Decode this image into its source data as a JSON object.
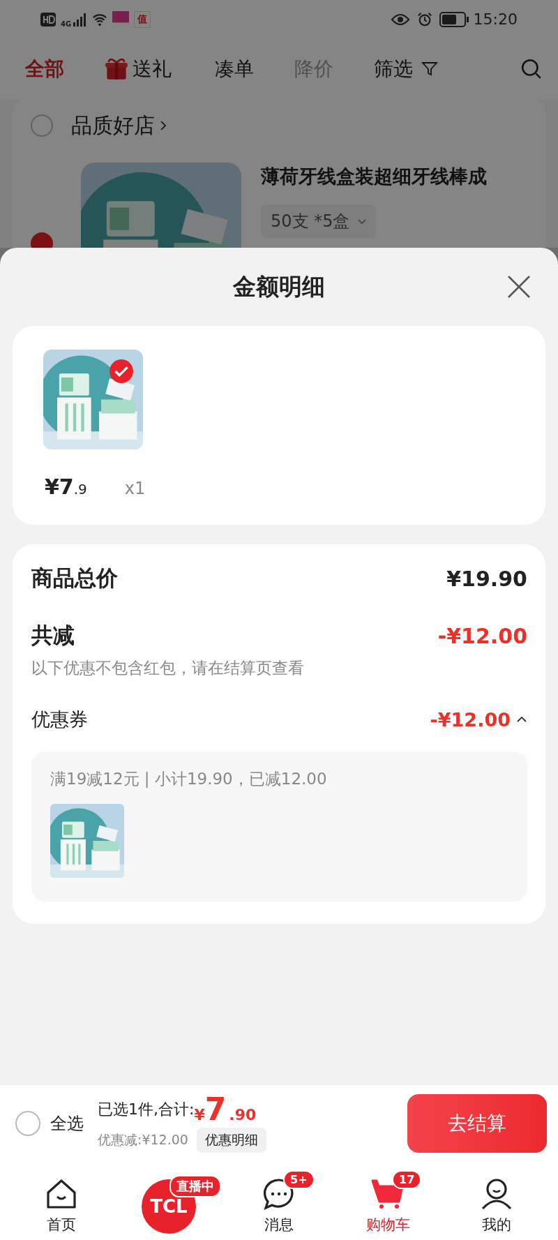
{
  "status_bar": {
    "network": "4G",
    "app_badge": "值",
    "time": "15:20"
  },
  "tabs": [
    {
      "label": "全部",
      "kind": "plain",
      "selected": true,
      "disabled": false
    },
    {
      "label": "送礼",
      "kind": "gift",
      "selected": false,
      "disabled": false
    },
    {
      "label": "凑单",
      "kind": "plain",
      "selected": false,
      "disabled": false
    },
    {
      "label": "降价",
      "kind": "plain",
      "selected": false,
      "disabled": true
    },
    {
      "label": "筛选",
      "kind": "filter",
      "selected": false,
      "disabled": false
    }
  ],
  "store": {
    "name": "品质好店",
    "checked": false
  },
  "product": {
    "title": "薄荷牙线盒装超细牙线棒成",
    "spec": "50支 *5盒",
    "checked": true
  },
  "sheet": {
    "title": "金额明细",
    "items": [
      {
        "price_main": "¥7",
        "price_decimal": ".9",
        "quantity": "x1",
        "checked": true
      }
    ],
    "summary": {
      "total_label": "商品总价",
      "total": "¥19.90",
      "discount_label": "共减",
      "discount": "-¥12.00",
      "note": "以下优惠不包含红包，请在结算页查看",
      "coupon_label": "优惠券",
      "coupon_amount": "-¥12.00",
      "coupon_expanded": true,
      "coupon_detail": "满19减12元 | 小计19.90，已减12.00"
    }
  },
  "checkout": {
    "select_all_label": "全选",
    "select_all_checked": false,
    "selected_text": "已选1件,合计:",
    "currency": "¥",
    "amount_main": "7",
    "amount_decimal": ".90",
    "savings": "优惠减:¥12.00",
    "detail_button": "优惠明细",
    "checkout_button": "去结算"
  },
  "nav": [
    {
      "kind": "home",
      "label": "首页",
      "selected": false
    },
    {
      "kind": "live",
      "logo": "TCL",
      "badge": "直播中"
    },
    {
      "kind": "message",
      "label": "消息",
      "badge": "5+",
      "selected": false
    },
    {
      "kind": "cart",
      "label": "购物车",
      "badge": "17",
      "selected": true
    },
    {
      "kind": "profile",
      "label": "我的",
      "selected": false
    }
  ]
}
